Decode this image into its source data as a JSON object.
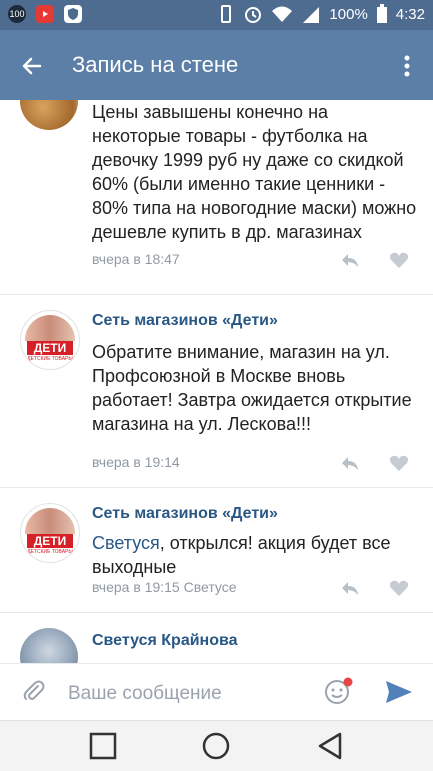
{
  "status_bar": {
    "notif_1": "100",
    "battery": "100%",
    "time": "4:32"
  },
  "app_bar": {
    "title": "Запись на стене"
  },
  "comments": [
    {
      "author": "",
      "text": "Цены завышены конечно на некоторые товары - футболка на девочку 1999 руб ну даже со скидкой 60% (были именно такие ценники - 80% типа на новогодние маски) можно дешевле купить в др. магазинах",
      "time": "вчера в 18:47"
    },
    {
      "author": "Сеть магазинов «Дети»",
      "text": "Обратите внимание, магазин на ул. Профсоюзной в Москве вновь работает! Завтра ожидается открытие магазина на ул. Лескова!!!",
      "time": "вчера в 19:14",
      "avatar_label": "ДЕТИ",
      "avatar_sub": "ДЕТСКИЕ ТОВАРЫ"
    },
    {
      "author": "Сеть магазинов «Дети»",
      "mention": "Светуся",
      "text": ", открылся! акция будет все выходные",
      "time": "вчера в 19:15 Светусе",
      "avatar_label": "ДЕТИ",
      "avatar_sub": "ДЕТСКИЕ ТОВАРЫ"
    },
    {
      "author": "Светуся Крайнова"
    }
  ],
  "composer": {
    "placeholder": "Ваше сообщение"
  },
  "icons": {
    "back": "arrow-left-icon",
    "more": "more-vert-icon",
    "reply": "reply-icon",
    "like": "heart-icon",
    "attach": "paperclip-icon",
    "emoji": "emoji-icon",
    "send": "send-icon"
  },
  "colors": {
    "status_bar": "#4e6c8f",
    "app_bar": "#5b7fa6",
    "link": "#2a5885",
    "meta": "#8f99a3"
  }
}
